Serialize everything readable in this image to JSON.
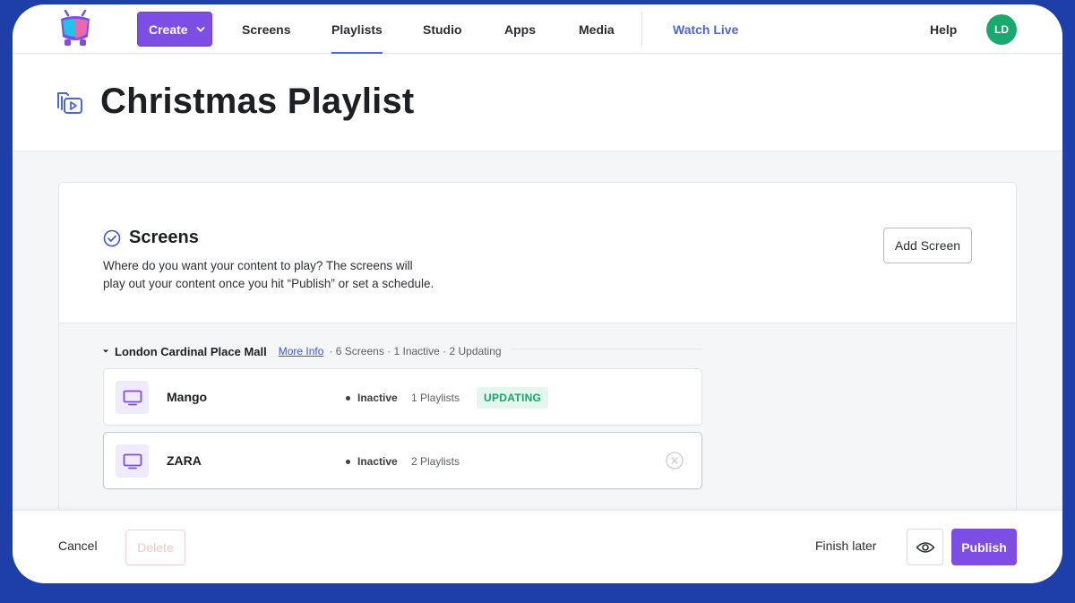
{
  "nav": {
    "create_label": "Create",
    "items": [
      {
        "label": "Screens"
      },
      {
        "label": "Playlists",
        "active": true
      },
      {
        "label": "Studio"
      },
      {
        "label": "Apps"
      },
      {
        "label": "Media"
      }
    ],
    "watch_live": "Watch Live",
    "help": "Help",
    "avatar_initials": "LD"
  },
  "header": {
    "title": "Christmas Playlist",
    "icon": "playlist-icon"
  },
  "section": {
    "title": "Screens",
    "description": "Where do you want your content to play? The screens will play out your content once you hit “Publish” or set a schedule.",
    "add_button": "Add Screen"
  },
  "group": {
    "name": "London Cardinal Place Mall",
    "more_info": "More Info",
    "meta": "· 6 Screens · 1 Inactive · 2 Updating"
  },
  "screens": [
    {
      "name": "Mango",
      "status": "Inactive",
      "playlists": "1 Playlists",
      "badge": "UPDATING"
    },
    {
      "name": "ZARA",
      "status": "Inactive",
      "playlists": "2 Playlists",
      "badge": ""
    }
  ],
  "footer": {
    "cancel": "Cancel",
    "delete": "Delete",
    "finish_later": "Finish later",
    "publish": "Publish"
  },
  "colors": {
    "accent": "#7c4ee4",
    "link": "#4a67d6",
    "success": "#19a96f",
    "frame_background": "#1f3fa8"
  }
}
